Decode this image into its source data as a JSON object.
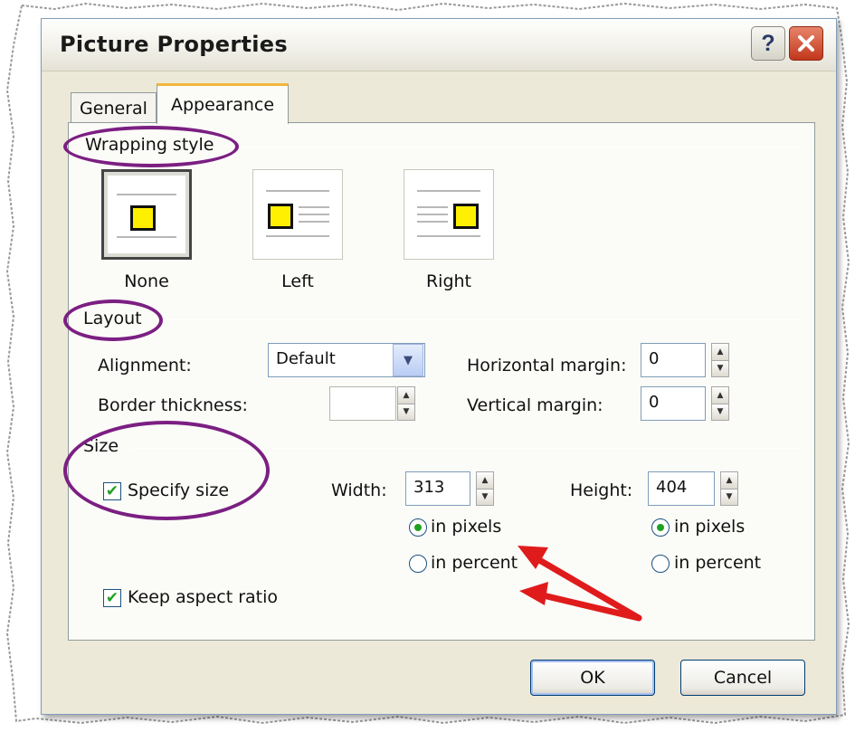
{
  "dialog": {
    "title": "Picture Properties",
    "help_label": "?",
    "close_label": "✕"
  },
  "tabs": [
    {
      "label": "General",
      "selected": false
    },
    {
      "label": "Appearance",
      "selected": true
    }
  ],
  "wrapping": {
    "group_label": "Wrapping style",
    "options": [
      {
        "label": "None",
        "selected": true
      },
      {
        "label": "Left",
        "selected": false
      },
      {
        "label": "Right",
        "selected": false
      }
    ]
  },
  "layout": {
    "group_label": "Layout",
    "alignment_label": "Alignment:",
    "alignment_value": "Default",
    "border_label": "Border thickness:",
    "border_value": "",
    "hmargin_label": "Horizontal margin:",
    "hmargin_value": "0",
    "vmargin_label": "Vertical margin:",
    "vmargin_value": "0"
  },
  "size": {
    "group_label": "Size",
    "specify_label": "Specify size",
    "specify_checked": true,
    "width_label": "Width:",
    "width_value": "313",
    "height_label": "Height:",
    "height_value": "404",
    "in_pixels_label": "in pixels",
    "in_percent_label": "in percent",
    "width_unit": "pixels",
    "height_unit": "pixels",
    "keep_ratio_label": "Keep aspect ratio",
    "keep_ratio_checked": true
  },
  "buttons": {
    "ok_label": "OK",
    "cancel_label": "Cancel"
  },
  "colors": {
    "annotation_ring": "#7b1f82",
    "annotation_arrow": "#e01b1b",
    "tab_highlight": "#f2b63b",
    "wrap_square": "#ffef00",
    "check_mark": "#21a121"
  }
}
